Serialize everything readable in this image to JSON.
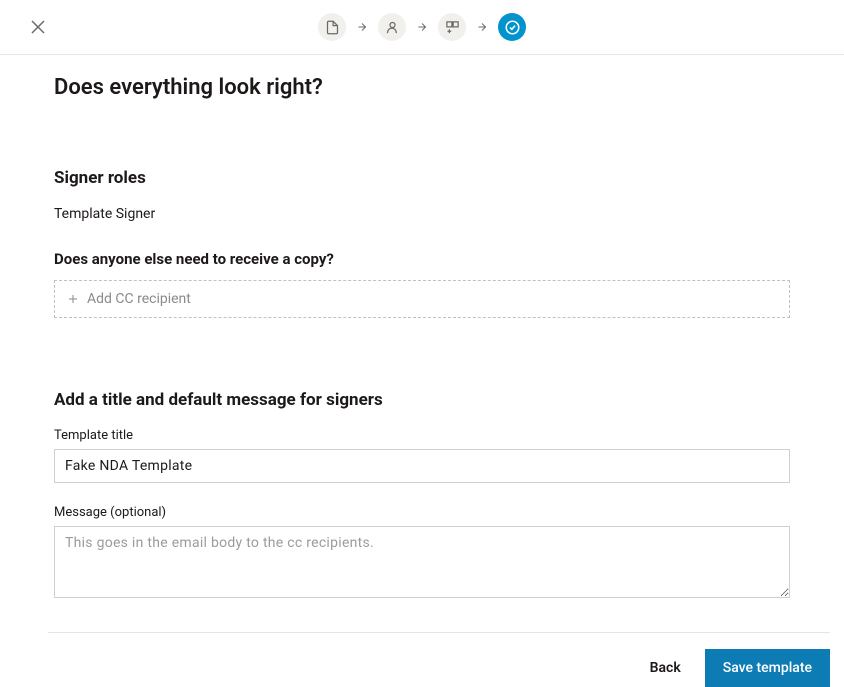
{
  "page": {
    "title": "Does everything look right?"
  },
  "signer_roles": {
    "heading": "Signer roles",
    "items": [
      "Template Signer"
    ]
  },
  "cc": {
    "heading": "Does anyone else need to receive a copy?",
    "placeholder": "Add CC recipient"
  },
  "message_section": {
    "heading": "Add a title and default message for signers",
    "title_label": "Template title",
    "title_value": "Fake NDA Template",
    "message_label": "Message (optional)",
    "message_placeholder": "This goes in the email body to the cc recipients.",
    "message_value": ""
  },
  "footer": {
    "back": "Back",
    "save": "Save template"
  }
}
